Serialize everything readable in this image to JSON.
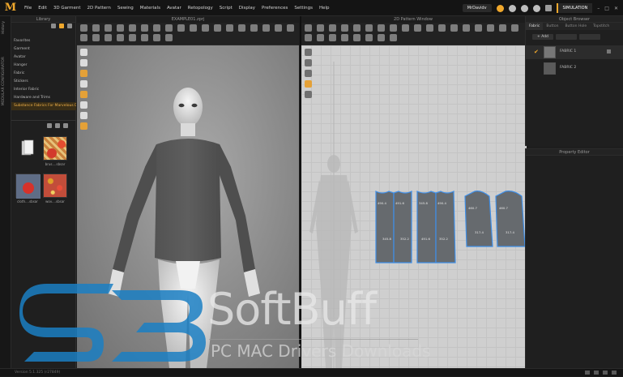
{
  "app": {
    "logo": "M"
  },
  "menu": {
    "items": [
      "File",
      "Edit",
      "3D Garment",
      "2D Pattern",
      "Sewing",
      "Materials",
      "Avatar",
      "Retopology",
      "Script",
      "Display",
      "Preferences",
      "Settings",
      "Help"
    ],
    "user": "MrDavidv",
    "mode": "SIMULATION"
  },
  "side_tabs": [
    "History",
    "MODULAR CONFIGURATOR"
  ],
  "library": {
    "title": "Library",
    "items": [
      "Favorites",
      "Garment",
      "Avatar",
      "Hanger",
      "Fabric",
      "Stickers",
      "Interior Fabric",
      "Hardware and Trims",
      "Substance Fabrics For Marvelous De"
    ],
    "selected_index": 8,
    "thumbs": [
      "brus....sbsar",
      "cloth....sbsar",
      "wov....sbsar"
    ]
  },
  "window3d": {
    "title": "EXAMPLE01.zprj"
  },
  "window2d": {
    "title": "2D Pattern Window"
  },
  "object_browser": {
    "title": "Object Browser",
    "tabs": [
      "Fabric",
      "Button",
      "Button Hole",
      "Topstitch"
    ],
    "actions": {
      "add": "+ Add"
    },
    "fabrics": [
      {
        "name": "FABRIC 1",
        "color": "#777777",
        "selected": true
      },
      {
        "name": "FABRIC 2",
        "color": "#5b5b5b",
        "selected": false
      }
    ]
  },
  "property_editor": {
    "title": "Property Editor"
  },
  "status": {
    "text": "Version 5.1.325 (r27849)"
  },
  "watermark": {
    "brand": "SoftBuff",
    "subtitle": "PC MAC Drivers Downloads",
    "letters": "SB"
  },
  "pattern_labels": [
    "490.4",
    "491.6",
    "345.8",
    "352.2",
    "345.8",
    "490.4",
    "491.6",
    "352.2",
    "460.7",
    "460.7",
    "317.4",
    "317.4"
  ],
  "colors": {
    "accent": "#f0a82c",
    "pattern_fill": "#666a6e",
    "pattern_outline": "#3f8fe8"
  }
}
